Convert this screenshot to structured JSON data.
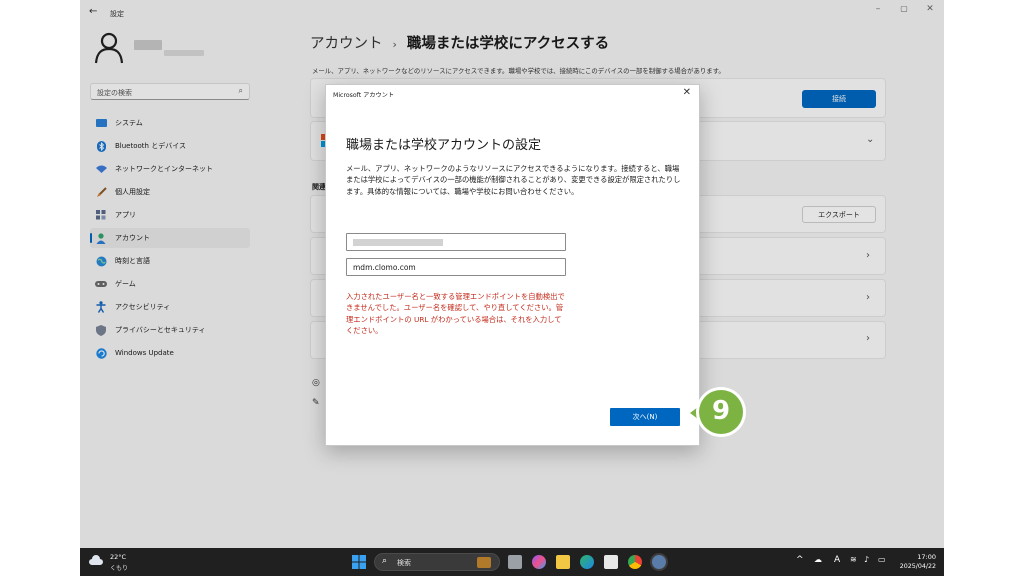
{
  "window": {
    "title": "設定",
    "back_glyph": "←",
    "minimize_glyph": "–",
    "maximize_glyph": "▢",
    "close_glyph": "✕"
  },
  "sidebar": {
    "search_placeholder": "設定の検索",
    "items": [
      {
        "label": "システム",
        "icon": "monitor-icon",
        "color": "#2a7fd6"
      },
      {
        "label": "Bluetooth とデバイス",
        "icon": "bluetooth-icon",
        "color": "#1976d2"
      },
      {
        "label": "ネットワークとインターネット",
        "icon": "wifi-icon",
        "color": "#3b7bd8"
      },
      {
        "label": "個人用設定",
        "icon": "brush-icon",
        "color": "#d27a2a"
      },
      {
        "label": "アプリ",
        "icon": "apps-icon",
        "color": "#5a6a8a"
      },
      {
        "label": "アカウント",
        "icon": "person-icon",
        "color": "#2fa36b",
        "selected": true
      },
      {
        "label": "時刻と言語",
        "icon": "globe-icon",
        "color": "#2a8ad6"
      },
      {
        "label": "ゲーム",
        "icon": "gamepad-icon",
        "color": "#6a6a6a"
      },
      {
        "label": "アクセシビリティ",
        "icon": "accessibility-icon",
        "color": "#1565c0"
      },
      {
        "label": "プライバシーとセキュリティ",
        "icon": "shield-icon",
        "color": "#7a8496"
      },
      {
        "label": "Windows Update",
        "icon": "update-icon",
        "color": "#1e88e5"
      }
    ]
  },
  "main": {
    "breadcrumb_parent": "アカウント",
    "breadcrumb_sep": "›",
    "breadcrumb_current": "職場または学校にアクセスする",
    "description": "メール、アプリ、ネットワークなどのリソースにアクセスできます。職場や学校では、接続時にこのデバイスの一部を制御する場合があります。",
    "connect_label": "接続",
    "related_label": "関連",
    "export_label": "エクスポート",
    "chevron_right": "›",
    "chevron_down": "⌄"
  },
  "dialog": {
    "window_title": "Microsoft アカウント",
    "close_glyph": "✕",
    "heading": "職場または学校アカウントの設定",
    "description": "メール、アプリ、ネットワークのようなリソースにアクセスできるようになります。接続すると、職場または学校によってデバイスの一部の機能が制御されることがあり、変更できる設定が限定されたりします。具体的な情報については、職場や学校にお問い合わせください。",
    "server_value": "mdm.clomo.com",
    "error": "入力されたユーザー名と一致する管理エンドポイントを自動検出できませんでした。ユーザー名を確認して、やり直してください。管理エンドポイントの URL がわかっている場合は、それを入力してください。",
    "next_label": "次へ(N)"
  },
  "marker": {
    "number": "9",
    "color": "#7cb342"
  },
  "taskbar": {
    "temperature": "22°C",
    "condition": "くもり",
    "search_label": "検索",
    "time": "17:00",
    "date": "2025/04/22",
    "ime_label": "A"
  },
  "colors": {
    "accent": "#0067c0",
    "error": "#c42b1c",
    "taskbar": "#202020"
  }
}
